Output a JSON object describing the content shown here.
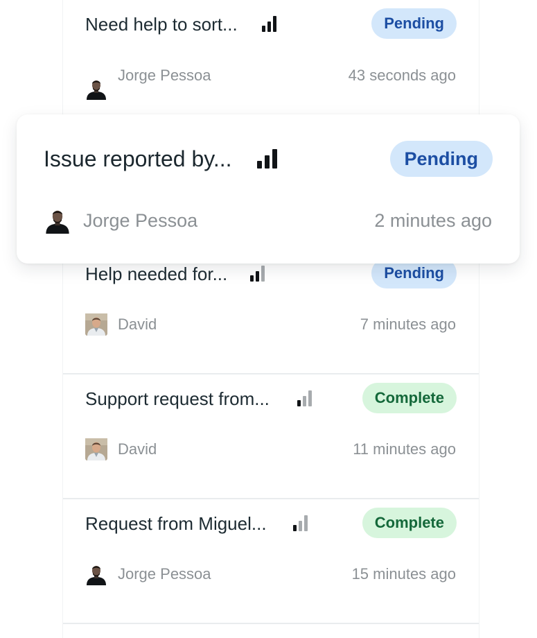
{
  "items": [
    {
      "title": "Need help to sort...",
      "priority": 3,
      "status": "Pending",
      "status_kind": "pending",
      "user": "Jorge Pessoa",
      "avatar": "jorge",
      "time": "43 seconds ago"
    },
    {
      "title": "Issue reported by...",
      "priority": 3,
      "status": "Pending",
      "status_kind": "pending",
      "user": "Jorge Pessoa",
      "avatar": "jorge",
      "time": "2 minutes ago"
    },
    {
      "title": "Help needed for...",
      "priority": 2,
      "status": "Pending",
      "status_kind": "pending",
      "user": "David",
      "avatar": "david",
      "time": "7 minutes ago"
    },
    {
      "title": "Support request from...",
      "priority": 1,
      "status": "Complete",
      "status_kind": "complete",
      "user": "David",
      "avatar": "david",
      "time": "11 minutes ago"
    },
    {
      "title": "Request from Miguel...",
      "priority": 1,
      "status": "Complete",
      "status_kind": "complete",
      "user": "Jorge Pessoa",
      "avatar": "jorge",
      "time": "15 minutes ago"
    }
  ],
  "colors": {
    "pending_bg": "#d3e7fb",
    "pending_text": "#1c4ea3",
    "complete_bg": "#d7f5dd",
    "complete_text": "#14683a",
    "bar_on": "#111417",
    "bar_off": "#a7abae"
  },
  "icons": {
    "priority": "signal-bars-icon",
    "avatar_jorge": "person-silhouette-avatar",
    "avatar_david": "person-photo-avatar"
  }
}
